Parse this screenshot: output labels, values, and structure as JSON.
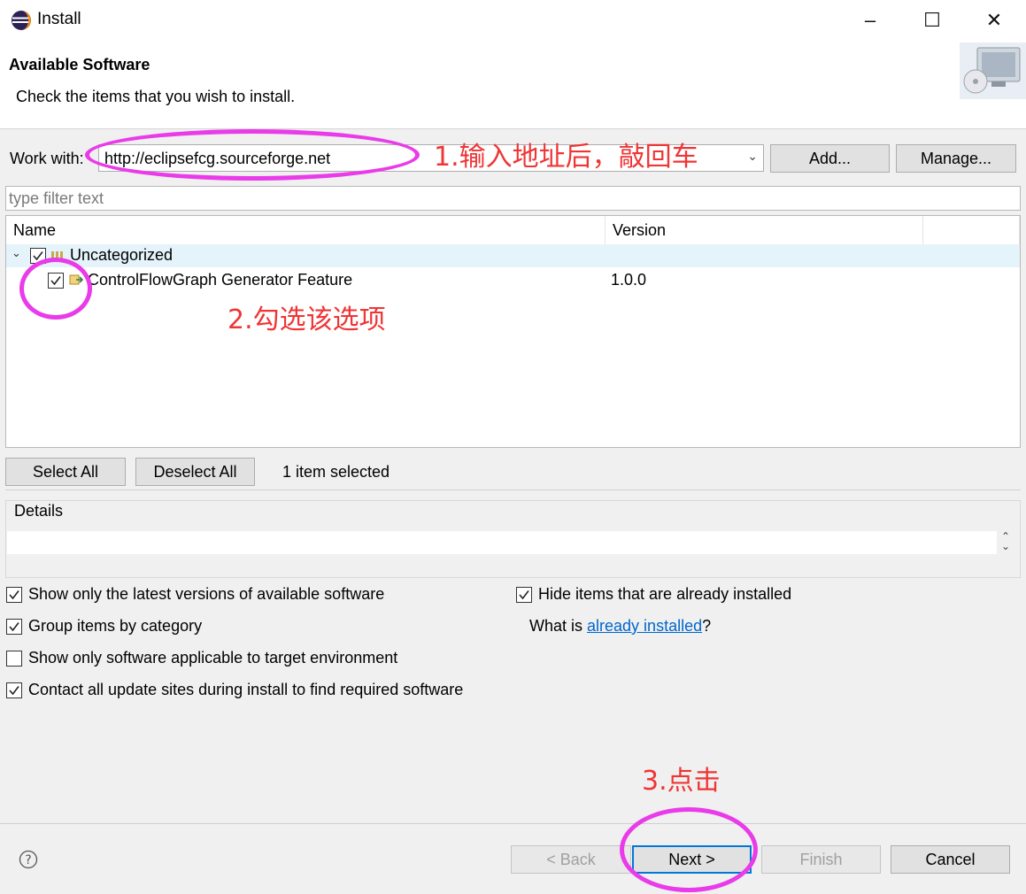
{
  "window": {
    "title": "Install",
    "controls": [
      "–",
      "☐",
      "✕"
    ]
  },
  "banner": {
    "title": "Available Software",
    "message": "Check the items that you wish to install."
  },
  "work_with": {
    "label": "Work with:",
    "value": "http://eclipsefcg.sourceforge.net",
    "add_label": "Add...",
    "manage_label": "Manage..."
  },
  "filter": {
    "placeholder": "type filter text"
  },
  "table": {
    "columns": [
      "Name",
      "Version"
    ],
    "rows": [
      {
        "name": "Uncategorized",
        "version": "",
        "checked": true,
        "expanded": true
      },
      {
        "name": "ControlFlowGraph Generator Feature",
        "version": "1.0.0",
        "checked": true
      }
    ]
  },
  "selection": {
    "select_all": "Select All",
    "deselect_all": "Deselect All",
    "status": "1 item selected"
  },
  "details": {
    "label": "Details"
  },
  "options": {
    "latest_versions": {
      "label": "Show only the latest versions of available software",
      "checked": true
    },
    "group_by_category": {
      "label": "Group items by category",
      "checked": true
    },
    "target_env": {
      "label": "Show only software applicable to target environment",
      "checked": false
    },
    "contact_sites": {
      "label": "Contact all update sites during install to find required software",
      "checked": true
    },
    "hide_installed": {
      "label": "Hide items that are already installed",
      "checked": true
    },
    "what_is": {
      "prefix": "What is ",
      "link": "already installed",
      "suffix": "?"
    }
  },
  "footer": {
    "back": "< Back",
    "next": "Next >",
    "finish": "Finish",
    "cancel": "Cancel"
  },
  "annotations": {
    "step1": "1.输入地址后，敲回车",
    "step2": "2.勾选该选项",
    "step3": "3.点击"
  },
  "colors": {
    "annotation_text": "#ef3535",
    "annotation_ellipse": "#e93be9",
    "link": "#0066cc",
    "selected_row": "#e5f3fb"
  }
}
